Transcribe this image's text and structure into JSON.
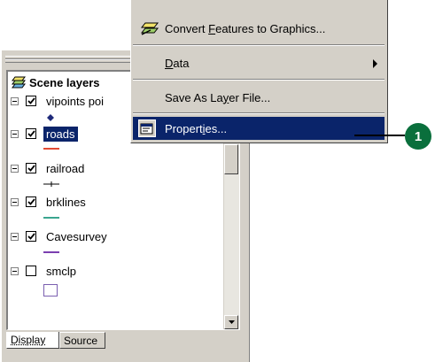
{
  "toc": {
    "root_title": "Scene layers",
    "layers": [
      {
        "name": "vipoints poi",
        "checked": true,
        "selected": false,
        "symbol": "diamond",
        "color": "#1f2a7a"
      },
      {
        "name": "roads",
        "checked": true,
        "selected": true,
        "symbol": "line",
        "color": "#e34a33"
      },
      {
        "name": "railroad",
        "checked": true,
        "selected": false,
        "symbol": "railroad",
        "color": "#000000"
      },
      {
        "name": "brklines",
        "checked": true,
        "selected": false,
        "symbol": "line",
        "color": "#3aa58f"
      },
      {
        "name": "Cavesurvey",
        "checked": true,
        "selected": false,
        "symbol": "line",
        "color": "#7b3fb0"
      },
      {
        "name": "smclp",
        "checked": false,
        "selected": false,
        "symbol": "box",
        "color": "#7b5fb0"
      }
    ],
    "tabs": [
      {
        "label": "Display",
        "active": true
      },
      {
        "label": "Source",
        "active": false
      }
    ]
  },
  "menu": {
    "items": [
      {
        "label_pre": "Convert ",
        "label_u": "F",
        "label_post": "eatures to Graphics...",
        "icon": "convert-features-icon",
        "highlighted": false
      },
      {
        "label_pre": "",
        "label_u": "D",
        "label_post": "ata",
        "icon": "",
        "highlighted": false,
        "submenu": true
      },
      {
        "label_pre": "Save As La",
        "label_u": "y",
        "label_post": "er File...",
        "icon": "",
        "highlighted": false
      },
      {
        "label_pre": "Propert",
        "label_u": "i",
        "label_post": "es...",
        "icon": "properties-icon",
        "highlighted": true
      }
    ]
  },
  "callout": {
    "number": "1"
  },
  "colors": {
    "highlight": "#0a246a",
    "face": "#d4d0c8",
    "callout": "#0a6f3c"
  }
}
